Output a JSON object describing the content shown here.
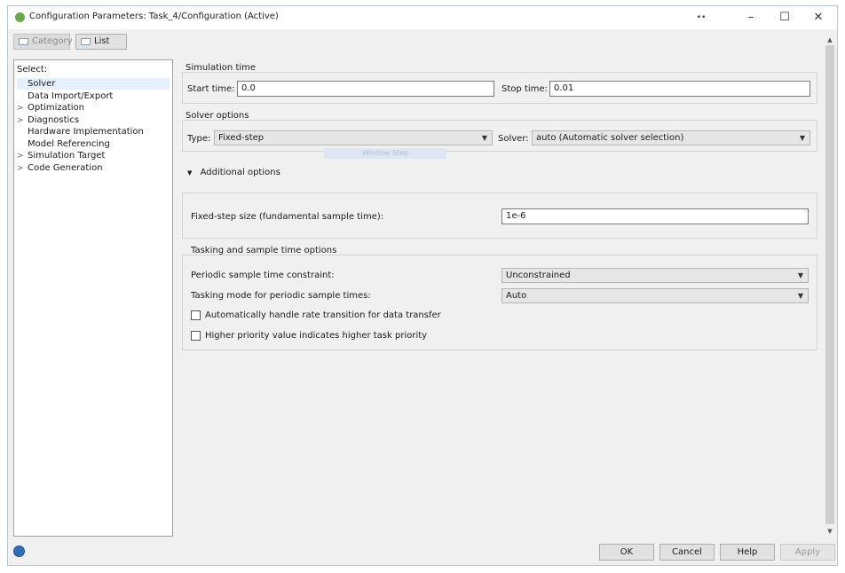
{
  "window": {
    "title": "Configuration Parameters: Task_4/Configuration (Active)",
    "controls": {
      "extra": "••",
      "minimize": "–",
      "maximize": "☐",
      "close": "✕"
    }
  },
  "toolbar": {
    "category_label": "Category",
    "list_label": "List"
  },
  "tree": {
    "select_label": "Select:",
    "items": [
      {
        "label": "Solver",
        "expandable": false,
        "active": true
      },
      {
        "label": "Data Import/Export",
        "expandable": false
      },
      {
        "label": "Optimization",
        "expandable": true
      },
      {
        "label": "Diagnostics",
        "expandable": true
      },
      {
        "label": "Hardware Implementation",
        "expandable": false
      },
      {
        "label": "Model Referencing",
        "expandable": false
      },
      {
        "label": "Simulation Target",
        "expandable": true
      },
      {
        "label": "Code Generation",
        "expandable": true
      }
    ],
    "expand_arrow": ">"
  },
  "simulation_time": {
    "title": "Simulation time",
    "start_label": "Start time:",
    "start_value": "0.0",
    "stop_label": "Stop time:",
    "stop_value": "0.01"
  },
  "solver_options": {
    "title": "Solver options",
    "type_label": "Type:",
    "type_value": "Fixed-step",
    "solver_label": "Solver:",
    "solver_value": "auto (Automatic solver selection)",
    "tooltip": "Window Step"
  },
  "additional": {
    "toggle_icon": "▼",
    "label": "Additional options",
    "fixed_step_label": "Fixed-step size (fundamental sample time):",
    "fixed_step_value": "1e-6"
  },
  "tasking": {
    "title": "Tasking and sample time options",
    "periodic_label": "Periodic sample time constraint:",
    "periodic_value": "Unconstrained",
    "mode_label": "Tasking mode for periodic sample times:",
    "mode_value": "Auto",
    "rate_transition_label": "Automatically handle rate transition for data transfer",
    "priority_label": "Higher priority value indicates higher task priority"
  },
  "caret": "▼",
  "buttons": {
    "ok": "OK",
    "cancel": "Cancel",
    "help": "Help",
    "apply": "Apply"
  }
}
